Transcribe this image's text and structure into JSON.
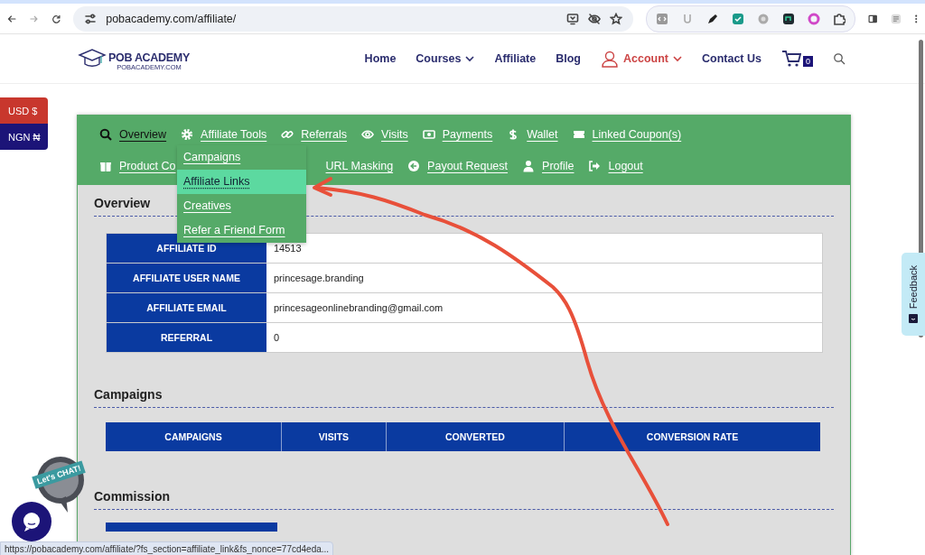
{
  "browser": {
    "url": "pobacademy.com/affiliate/"
  },
  "site": {
    "logo_title": "POB ACADEMY",
    "logo_subtitle": "POBACADEMY.COM",
    "nav": [
      {
        "label": "Home",
        "kind": "link"
      },
      {
        "label": "Courses",
        "kind": "dropdown"
      },
      {
        "label": "Affiliate",
        "kind": "link"
      },
      {
        "label": "Blog",
        "kind": "link"
      },
      {
        "label": "Account",
        "kind": "account"
      },
      {
        "label": "Contact Us",
        "kind": "link"
      }
    ],
    "cart_count": "0"
  },
  "currencies": [
    {
      "label": "USD $",
      "color": "#c8372d"
    },
    {
      "label": "NGN ₦",
      "color": "#1c1478"
    }
  ],
  "affiliate_nav": {
    "rows": [
      {
        "items": [
          {
            "label": "Overview",
            "selected": true
          },
          {
            "label": "Affiliate Tools",
            "selected": false
          },
          {
            "label": "Referrals",
            "selected": false
          },
          {
            "label": "Visits",
            "selected": false
          },
          {
            "label": "Payments",
            "selected": false
          },
          {
            "label": "Wallet",
            "selected": false
          },
          {
            "label": "Linked Coupon(s)",
            "selected": false
          }
        ]
      },
      {
        "items": [
          {
            "label": "Product Co",
            "selected": false
          },
          {
            "label": "URL Masking",
            "selected": false
          },
          {
            "label": "Payout Request",
            "selected": false
          },
          {
            "label": "Profile",
            "selected": false
          },
          {
            "label": "Logout",
            "selected": false
          }
        ]
      }
    ],
    "dropdown": [
      {
        "label": "Campaigns",
        "selected": false
      },
      {
        "label": "Affiliate Links",
        "selected": true
      },
      {
        "label": "Creatives",
        "selected": false
      },
      {
        "label": "Refer a Friend Form",
        "selected": false
      }
    ]
  },
  "overview": {
    "heading": "Overview",
    "rows": [
      {
        "label": "AFFILIATE ID",
        "value": "14513"
      },
      {
        "label": "AFFILIATE USER NAME",
        "value": "princesage.branding"
      },
      {
        "label": "AFFILIATE EMAIL",
        "value": "princesageonlinebranding@gmail.com"
      },
      {
        "label": "REFERRAL",
        "value": "0"
      }
    ]
  },
  "campaigns": {
    "heading": "Campaigns",
    "columns": [
      "CAMPAIGNS",
      "VISITS",
      "CONVERTED",
      "CONVERSION RATE"
    ]
  },
  "commission": {
    "heading": "Commission"
  },
  "feedback_tab": {
    "label": "Feedback"
  },
  "chat": {
    "badge": "Let's CHAT!"
  },
  "status_bar": {
    "url": "https://pobacademy.com/affiliate/?fs_section=affiliate_link&fs_nonce=77cd4eda..."
  }
}
